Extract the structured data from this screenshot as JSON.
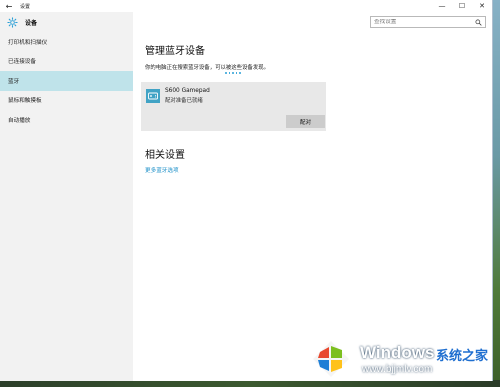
{
  "window": {
    "title": "设置",
    "back_glyph": "←",
    "minimize_glyph": "—",
    "maximize_glyph": "☐",
    "close_glyph": "✕"
  },
  "search": {
    "placeholder": "查找设置"
  },
  "sidebar": {
    "title": "设备",
    "items": [
      {
        "label": "打印机和扫描仪",
        "active": false
      },
      {
        "label": "已连接设备",
        "active": false
      },
      {
        "label": "蓝牙",
        "active": true
      },
      {
        "label": "鼠标和触摸板",
        "active": false
      },
      {
        "label": "自动播放",
        "active": false
      }
    ]
  },
  "main": {
    "title": "管理蓝牙设备",
    "description": "你的电脑正在搜索蓝牙设备，可以被这些设备发现。",
    "device": {
      "name": "S600 Gamepad",
      "status": "配对准备已就绪",
      "pair_label": "配对"
    },
    "related_title": "相关设置",
    "more_link": "更多蓝牙选项"
  },
  "watermark": {
    "windows_text": "Windows",
    "brand_text": "系统之家",
    "url_text": "www.bjjmlv.com"
  },
  "colors": {
    "accent": "#1a8ec7",
    "active_nav": "#bfe3ea",
    "sidebar_bg": "#f2f2f2",
    "card_bg": "#e8e8e8"
  },
  "icons": {
    "back": "arrow-left-icon",
    "settings": "gear-icon",
    "search": "search-icon",
    "device": "gamepad-icon"
  }
}
